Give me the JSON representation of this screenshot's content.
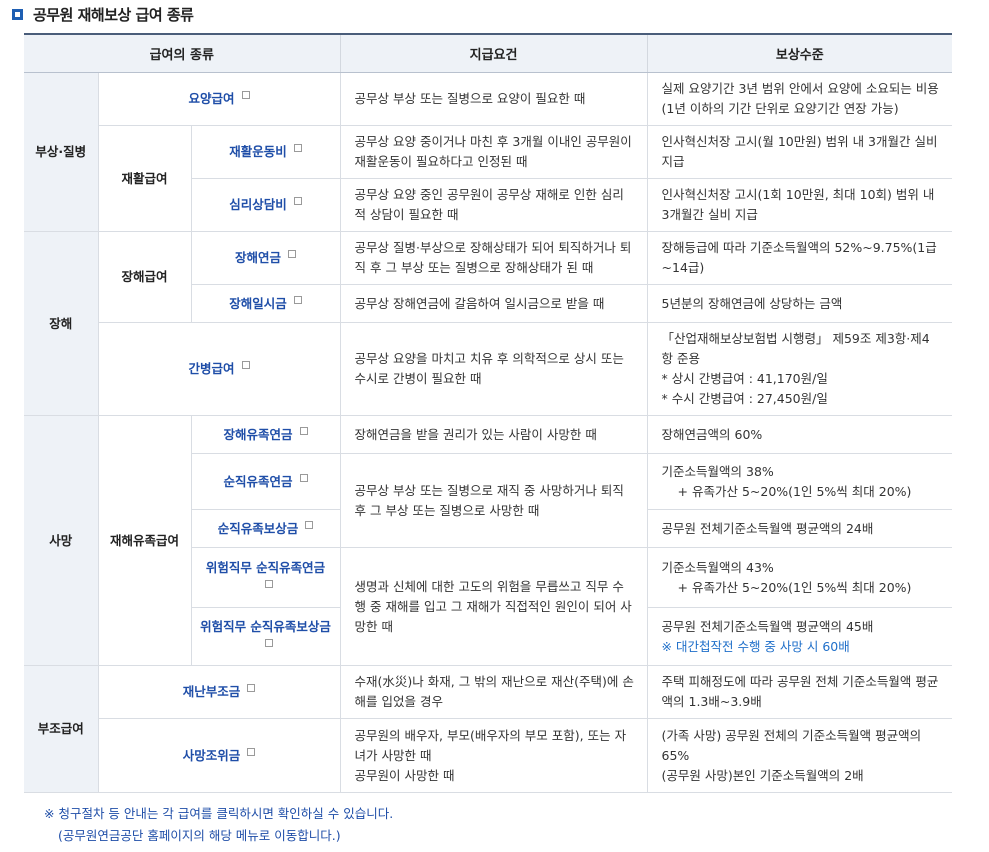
{
  "title": "공무원 재해보상 급여 종류",
  "headers": {
    "type": "급여의 종류",
    "cond": "지급요건",
    "level": "보상수준"
  },
  "cats": {
    "injury": "부상·질병",
    "disability": "장해",
    "death": "사망",
    "aid": "부조급여"
  },
  "subs": {
    "rehab": "재활급여",
    "disability": "장해급여",
    "survivor": "재해유족급여"
  },
  "rows": {
    "yoyang": {
      "name": "요양급여",
      "cond": "공무상 부상 또는 질병으로 요양이 필요한 때",
      "level": "실제 요양기간 3년 범위 안에서 요양에 소요되는 비용(1년 이하의 기간 단위로 요양기간 연장 가능)"
    },
    "exercise": {
      "name": "재활운동비",
      "cond": "공무상 요양 중이거나 마친 후 3개월 이내인 공무원이 재활운동이 필요하다고 인정된 때",
      "level": "인사혁신처장 고시(월 10만원) 범위 내 3개월간 실비 지급"
    },
    "counsel": {
      "name": "심리상담비",
      "cond": "공무상 요양 중인 공무원이 공무상 재해로 인한 심리적 상담이 필요한 때",
      "level": "인사혁신처장 고시(1회 10만원, 최대 10회) 범위 내 3개월간 실비 지급"
    },
    "pension": {
      "name": "장해연금",
      "cond": "공무상 질병·부상으로 장해상태가 되어 퇴직하거나 퇴직 후 그 부상 또는 질병으로 장해상태가 된 때",
      "level": "장해등급에 따라 기준소득월액의 52%~9.75%(1급~14급)"
    },
    "lump": {
      "name": "장해일시금",
      "cond": "공무상 장해연금에 갈음하여 일시금으로 받을 때",
      "level": "5년분의 장해연금에 상당하는 금액"
    },
    "nursing": {
      "name": "간병급여",
      "cond": "공무상 요양을 마치고 치유 후 의학적으로 상시 또는 수시로 간병이 필요한 때",
      "level1": "「산업재해보상보험법 시행령」 제59조 제3항·제4항 준용",
      "level2": "* 상시 간병급여 : 41,170원/일",
      "level3": "* 수시 간병급여 : 27,450원/일"
    },
    "disSurv": {
      "name": "장해유족연금",
      "cond": "장해연금을 받을 권리가 있는 사람이 사망한 때",
      "level": "장해연금액의 60%"
    },
    "dutySurv": {
      "name": "순직유족연금",
      "level1": "기준소득월액의 38%",
      "level2": "+ 유족가산 5~20%(1인 5%씩 최대 20%)"
    },
    "dutyComp": {
      "name": "순직유족보상금",
      "level": "공무원 전체기준소득월액 평균액의 24배"
    },
    "dutyShared": {
      "cond": "공무상 부상 또는 질병으로 재직 중 사망하거나 퇴직 후 그 부상 또는 질병으로 사망한 때"
    },
    "hazSurv": {
      "name": "위험직무 순직유족연금",
      "level1": "기준소득월액의 43%",
      "level2": "+ 유족가산 5~20%(1인 5%씩 최대 20%)"
    },
    "hazComp": {
      "name": "위험직무 순직유족보상금",
      "level1": "공무원 전체기준소득월액 평균액의 45배",
      "level2": "※ 대간첩작전 수행 중 사망 시 60배"
    },
    "hazShared": {
      "cond": "생명과 신체에 대한 고도의 위험을 무릅쓰고 직무 수행 중 재해를 입고 그 재해가 직접적인 원인이 되어 사망한 때"
    },
    "disaster": {
      "name": "재난부조금",
      "cond": "수재(水災)나 화재, 그 밖의 재난으로 재산(주택)에 손해를 입었을 경우",
      "level": "주택 피해정도에 따라 공무원 전체 기준소득월액 평균액의 1.3배~3.9배"
    },
    "condolence": {
      "name": "사망조위금",
      "cond1": "공무원의 배우자, 부모(배우자의 부모 포함), 또는 자녀가 사망한 때",
      "cond2": "공무원이 사망한 때",
      "level1": "(가족 사망) 공무원 전체의 기준소득월액 평균액의 65%",
      "level2": "(공무원 사망)본인 기준소득월액의 2배"
    }
  },
  "notes": {
    "line1": "※ 청구절차 등 안내는 각 급여를 클릭하시면 확인하실 수 있습니다.",
    "line2": "(공무원연금공단 홈페이지의 해당 메뉴로 이동합니다.)"
  }
}
